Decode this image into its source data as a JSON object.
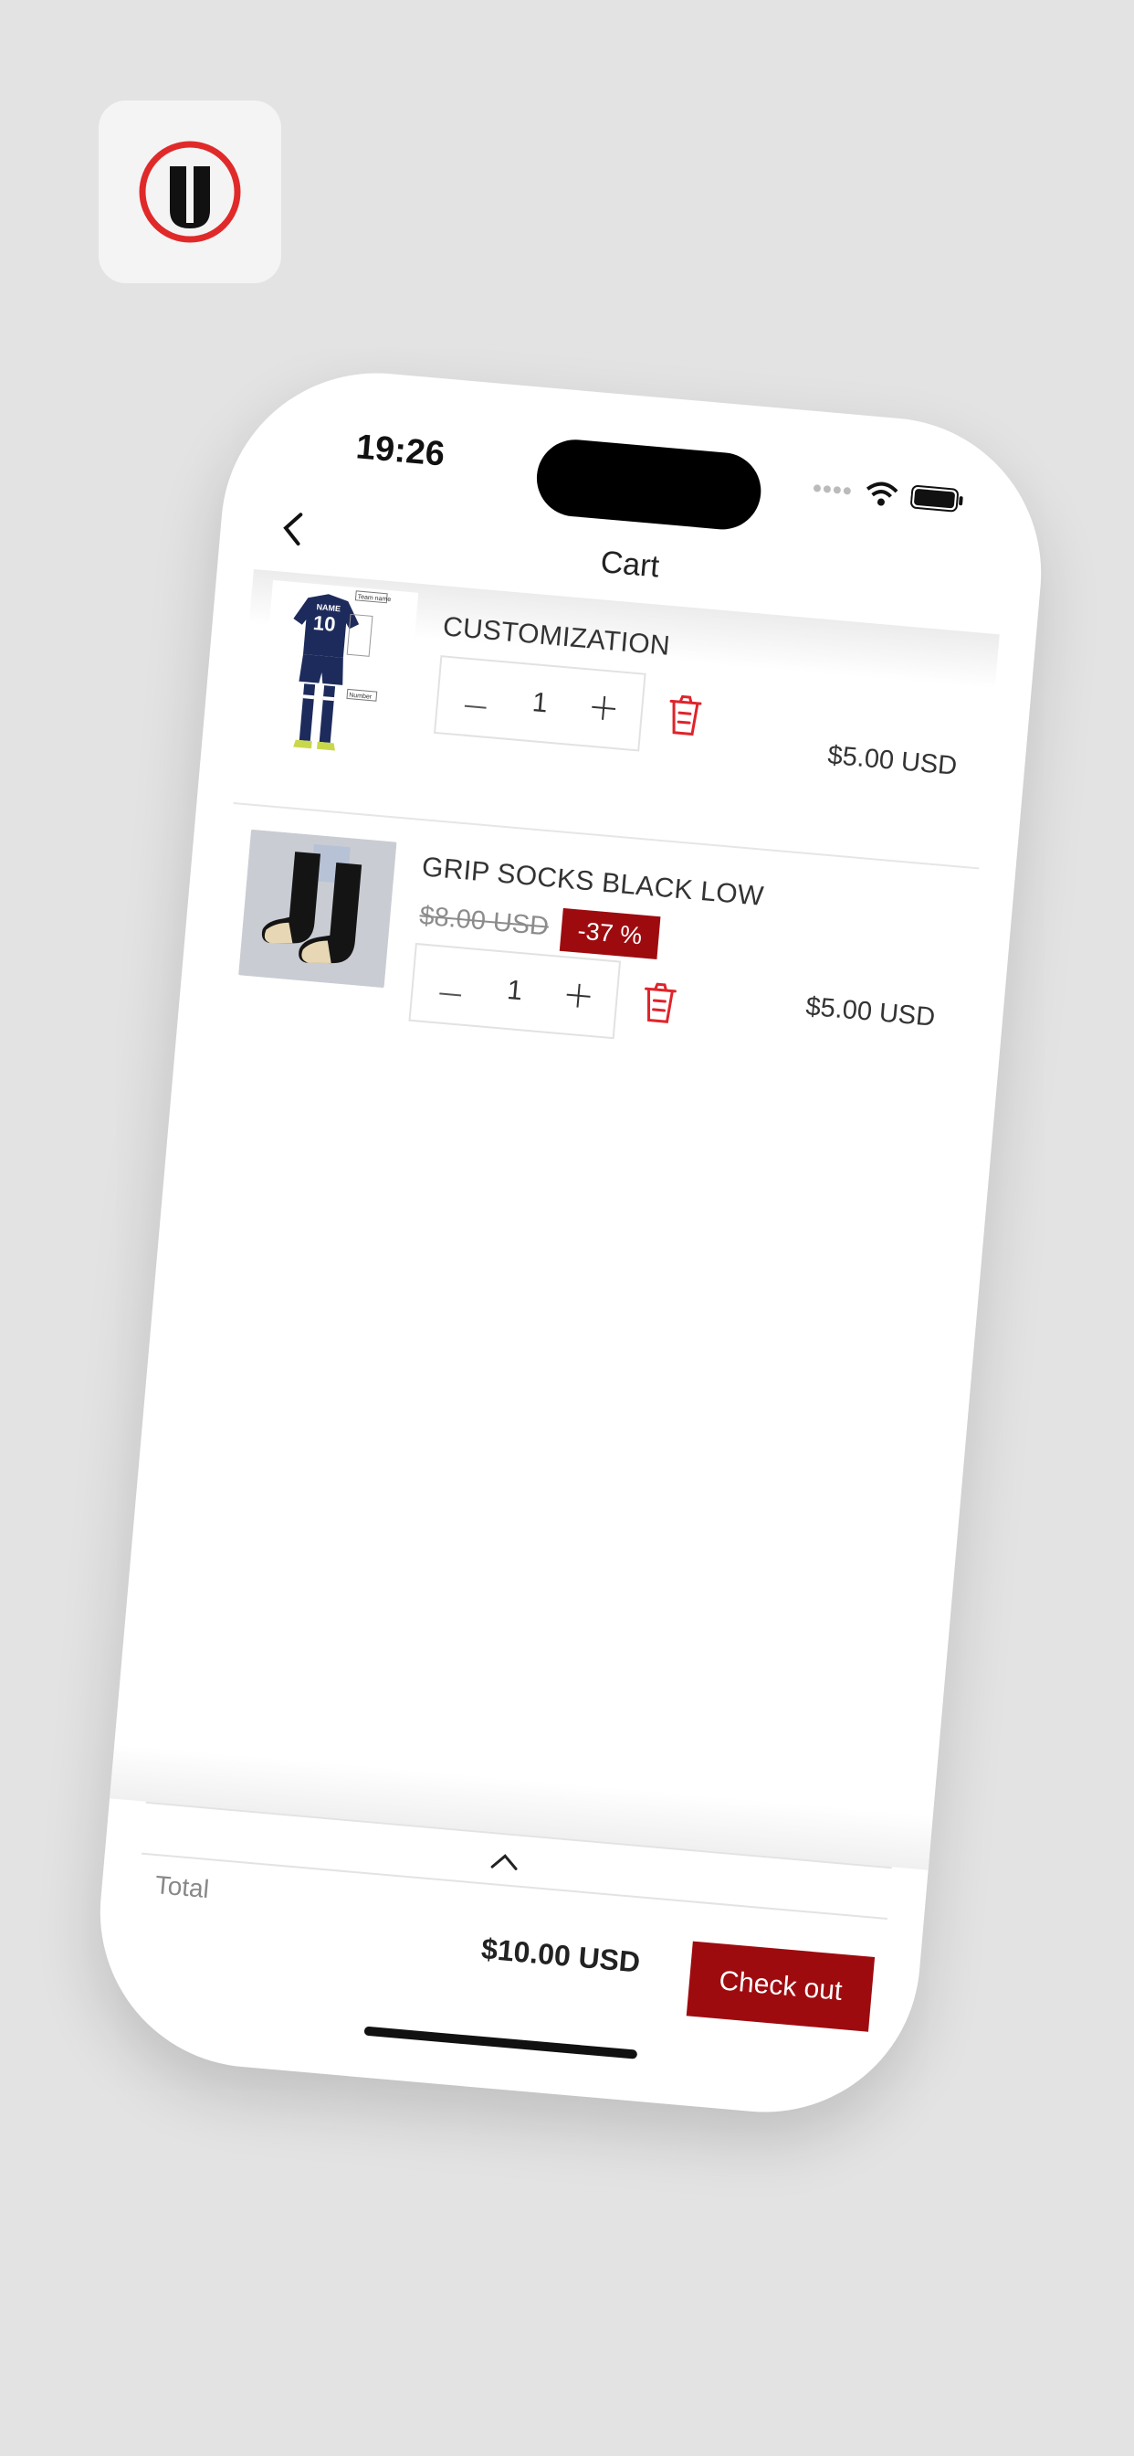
{
  "status_bar": {
    "time": "19:26"
  },
  "nav": {
    "title": "Cart"
  },
  "items": [
    {
      "name": "CUSTOMIZATION",
      "quantity": "1",
      "price": "$5.00 USD",
      "image_labels": {
        "shirt_name": "NAME",
        "shirt_number": "10",
        "team_name": "Team name",
        "number": "Number"
      }
    },
    {
      "name": "GRIP SOCKS BLACK LOW",
      "old_price": "$8.00 USD",
      "discount": "-37 %",
      "quantity": "1",
      "price": "$5.00 USD"
    }
  ],
  "footer": {
    "total_label": "Total",
    "total_value": "$10.00 USD",
    "checkout_label": "Check out"
  },
  "colors": {
    "accent": "#9e0b0f",
    "trash": "#e0232a",
    "background": "#e3e3e3"
  },
  "icons": [
    "back-chevron-icon",
    "trash-icon",
    "minus-icon",
    "plus-icon",
    "chevron-up-icon",
    "wifi-icon",
    "battery-icon",
    "signal-icon"
  ]
}
